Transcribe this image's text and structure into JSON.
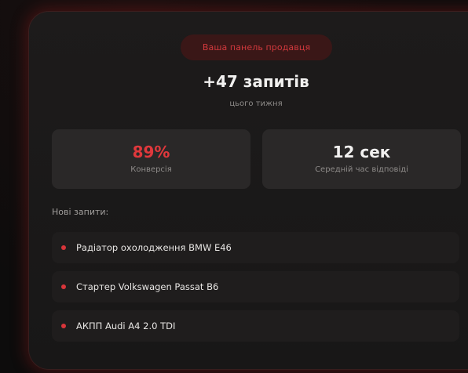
{
  "badge": "Ваша панель продавця",
  "headline": "+47 запитів",
  "subline": "цього тижня",
  "stats": [
    {
      "value": "89%",
      "label": "Конверсія",
      "color": "#e0383c"
    },
    {
      "value": "12 сек",
      "label": "Середній час відповіді",
      "color": "#f1f0ef"
    }
  ],
  "requests_title": "Нові запити:",
  "requests": [
    {
      "text": "Радіатор охолодження BMW E46"
    },
    {
      "text": "Стартер Volkswagen Passat B6"
    },
    {
      "text": "АКПП Audi A4 2.0 TDI"
    }
  ],
  "accent_color": "#d8353a"
}
